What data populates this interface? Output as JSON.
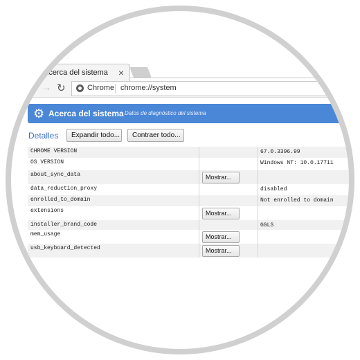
{
  "tab": {
    "title": "Acerca del sistema",
    "close": "×"
  },
  "toolbar": {
    "back": "←",
    "forward": "→",
    "reload": "↻",
    "chrome_label": "Chrome",
    "url": "chrome://system"
  },
  "header": {
    "title": "Acerca del sistema",
    "subtitle": "Datos de diagnóstico del sistema"
  },
  "details": {
    "label": "Detalles",
    "expand_all": "Expandir todo...",
    "collapse_all": "Contraer todo..."
  },
  "rows": [
    {
      "key": "CHROME VERSION",
      "value": "67.0.3396.99",
      "button": ""
    },
    {
      "key": "OS VERSION",
      "value": "Windows NT: 10.0.17711",
      "button": ""
    },
    {
      "key": "about_sync_data",
      "value": "",
      "button": "Mostrar..."
    },
    {
      "key": "data_reduction_proxy",
      "value": "disabled",
      "button": ""
    },
    {
      "key": "enrolled_to_domain",
      "value": "Not enrolled to domain",
      "button": ""
    },
    {
      "key": "extensions",
      "value": "",
      "button": "Mostrar..."
    },
    {
      "key": "installer_brand_code",
      "value": "GGLS",
      "button": ""
    },
    {
      "key": "mem_usage",
      "value": "",
      "button": "Mostrar..."
    },
    {
      "key": "usb_keyboard_detected",
      "value": "",
      "button": "Mostrar..."
    }
  ],
  "colors": {
    "header": "#4a87d6",
    "link": "#3b72c4",
    "ring": "#d0d0d0"
  },
  "icons": {
    "gear": "gear-icon",
    "chrome": "chrome-logo-icon",
    "close": "close-icon",
    "back": "back-arrow-icon",
    "forward": "forward-arrow-icon",
    "reload": "reload-icon"
  }
}
